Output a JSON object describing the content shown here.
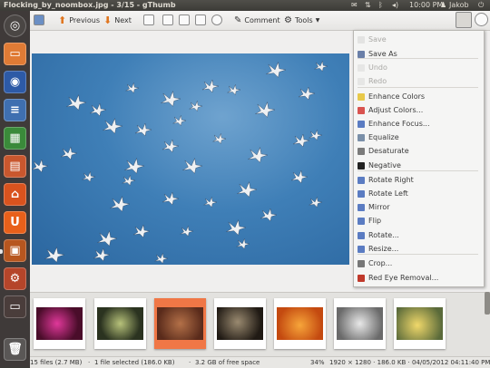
{
  "window_title": "Flocking_by_noombox.jpg - 3/15 - gThumb",
  "panel": {
    "clock": "10:00 PM",
    "user": "Jakob"
  },
  "toolbar": {
    "previous": "Previous",
    "next": "Next",
    "comment": "Comment",
    "tools": "Tools"
  },
  "tools_menu": [
    {
      "label": "Save",
      "enabled": false,
      "icon": "save-icon"
    },
    {
      "label": "Save As",
      "enabled": true,
      "icon": "save-as-icon"
    },
    {
      "label": "Undo",
      "enabled": false,
      "icon": "undo-icon"
    },
    {
      "label": "Redo",
      "enabled": false,
      "icon": "redo-icon"
    },
    {
      "label": "Enhance Colors",
      "enabled": true,
      "icon": "enhance-colors-icon"
    },
    {
      "label": "Adjust Colors...",
      "enabled": true,
      "icon": "adjust-colors-icon"
    },
    {
      "label": "Enhance Focus...",
      "enabled": true,
      "icon": "enhance-focus-icon"
    },
    {
      "label": "Equalize",
      "enabled": true,
      "icon": "equalize-icon"
    },
    {
      "label": "Desaturate",
      "enabled": true,
      "icon": "desaturate-icon"
    },
    {
      "label": "Negative",
      "enabled": true,
      "icon": "negative-icon"
    },
    {
      "label": "Rotate Right",
      "enabled": true,
      "icon": "rotate-right-icon"
    },
    {
      "label": "Rotate Left",
      "enabled": true,
      "icon": "rotate-left-icon"
    },
    {
      "label": "Mirror",
      "enabled": true,
      "icon": "mirror-icon"
    },
    {
      "label": "Flip",
      "enabled": true,
      "icon": "flip-icon"
    },
    {
      "label": "Rotate...",
      "enabled": true,
      "icon": "rotate-icon"
    },
    {
      "label": "Resize...",
      "enabled": true,
      "icon": "resize-icon"
    },
    {
      "label": "Crop...",
      "enabled": true,
      "icon": "crop-icon"
    },
    {
      "label": "Red Eye Removal...",
      "enabled": true,
      "icon": "red-eye-icon"
    }
  ],
  "status": {
    "files": "15 files (2.7 MB)",
    "selection": "1 file selected (186.0 KB)",
    "free": "3.2 GB of free space",
    "zoom": "34%",
    "info": "1920 × 1280 · 186.0 KB · 04/05/2012 04:11:40 PM"
  },
  "colors": {
    "accent": "#f07746",
    "sky": "#3f7fb7",
    "panel": "#3c3b37"
  }
}
